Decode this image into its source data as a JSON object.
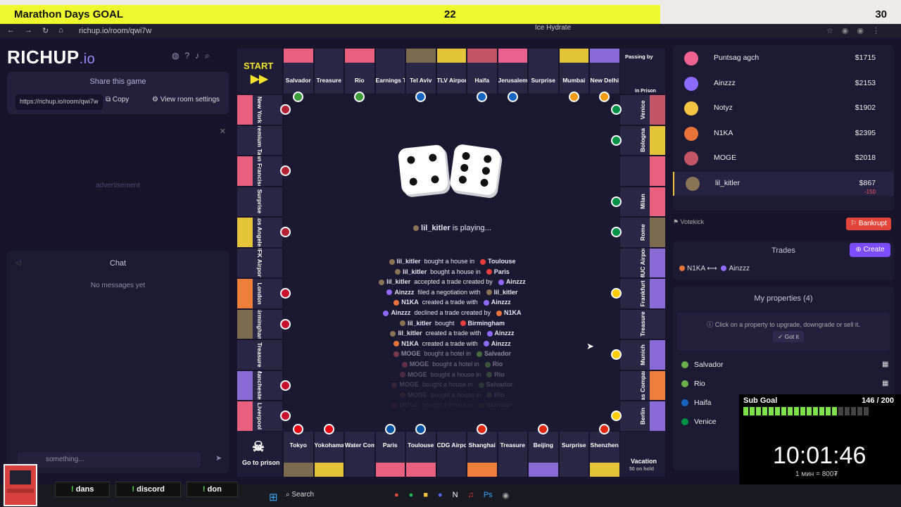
{
  "goal": {
    "title": "Marathon Days GOAL",
    "current": "22",
    "max": "30",
    "progress": 0.733
  },
  "browser": {
    "url": "richup.io/room/qwi7w",
    "tab": "Ice Hydrate"
  },
  "logo": {
    "main": "RICHUP",
    "suffix": ".io"
  },
  "share": {
    "title": "Share this game",
    "url": "https://richup.io/room/qwi7w",
    "copy": "Copy",
    "settings": "View room settings"
  },
  "ad": {
    "label": "advertisement"
  },
  "chat": {
    "title": "Chat",
    "empty": "No messages yet",
    "placeholder": "something..."
  },
  "board": {
    "start": "START",
    "passing": "Passing by",
    "in_prison": "In Prison",
    "go_prison": "Go to prison",
    "vacation": "Vacation",
    "vacation_sub": "50 on hold",
    "top": [
      {
        "name": "Salvador",
        "color": "#ffffff",
        "flag": "br"
      },
      {
        "name": "Treasure",
        "color": "#dba044",
        "label_top": "Treasure"
      },
      {
        "name": "Rio",
        "color": "#ffffff",
        "flag": "br"
      },
      {
        "name": "Earnings Tax",
        "sub": "%10"
      },
      {
        "name": "Tel Aviv",
        "color": "#7b6c4f",
        "flag": "il"
      },
      {
        "name": "TLV Airport",
        "color": "#e4c53a"
      },
      {
        "name": "Haifa",
        "color": "#c25666",
        "flag": "il"
      },
      {
        "name": "Jerusalem",
        "color": "#e7628f",
        "flag": "il"
      },
      {
        "name": "Surprise",
        "label_top": "Surprise"
      },
      {
        "name": "Mumbai",
        "color": "#e4c53a",
        "flag": "in"
      },
      {
        "name": "New Delhi",
        "color": "#8a6bd6",
        "flag": "in"
      }
    ],
    "left": [
      "New York",
      "Premium Tax",
      "San Francisco",
      "Surprise",
      "Los Angeles",
      "JFK Airport",
      "London",
      "Birmingham",
      "Treasure",
      "Manchester",
      "Liverpool"
    ],
    "left_sub": {
      "premium_tax": "$75",
      "jfk": "200$"
    },
    "right": [
      "Venice",
      "Bologna",
      "",
      "Milan",
      "Rome",
      "MUC Airport",
      "Frankfurt",
      "Treasure",
      "Munich",
      "Gas Company",
      "Berlin"
    ],
    "bottom": [
      "Tokyo",
      "Yokohama",
      "Water Company",
      "Paris",
      "Toulouse",
      "CDG Airport",
      "Shanghai",
      "Treasure",
      "Beijing",
      "Surprise",
      "Shenzhen"
    ],
    "bottom_sub": {
      "water": "150$"
    }
  },
  "center": {
    "playing_name": "lil_kitler",
    "playing_text": "is playing...",
    "log": [
      {
        "a": "lil_kitler",
        "ac": "#8b7355",
        "mid": "bought a house in",
        "b": "Toulouse",
        "bc": "#e84040",
        "op": 1
      },
      {
        "a": "lil_kitler",
        "ac": "#8b7355",
        "mid": "bought a house in",
        "b": "Paris",
        "bc": "#e84040",
        "op": 1
      },
      {
        "a": "lil_kitler",
        "ac": "#8b7355",
        "mid": "accepted a trade created by",
        "b": "Ainzzz",
        "bc": "#8b6cff",
        "op": 1
      },
      {
        "a": "Ainzzz",
        "ac": "#8b6cff",
        "mid": "filed a negotiation with",
        "b": "lil_kitler",
        "bc": "#8b7355",
        "op": 1
      },
      {
        "a": "N1KA",
        "ac": "#e9743a",
        "mid": "created a trade with",
        "b": "Ainzzz",
        "bc": "#8b6cff",
        "op": 1
      },
      {
        "a": "Ainzzz",
        "ac": "#8b6cff",
        "mid": "declined a trade created by",
        "b": "N1KA",
        "bc": "#e9743a",
        "op": 1
      },
      {
        "a": "lil_kitler",
        "ac": "#8b7355",
        "mid": "bought",
        "b": "Birmingham",
        "bc": "#e84040",
        "op": 1
      },
      {
        "a": "lil_kitler",
        "ac": "#8b7355",
        "mid": "created a trade with",
        "b": "Ainzzz",
        "bc": "#8b6cff",
        "op": 1
      },
      {
        "a": "N1KA",
        "ac": "#e9743a",
        "mid": "created a trade with",
        "b": "Ainzzz",
        "bc": "#8b6cff",
        "op": 1
      },
      {
        "a": "MOGE",
        "ac": "#c25666",
        "mid": "bought a hotel in",
        "b": "Salvador",
        "bc": "#6ab04c",
        "op": 0.55
      },
      {
        "a": "MOGE",
        "ac": "#c25666",
        "mid": "bought a hotel in",
        "b": "Rio",
        "bc": "#6ab04c",
        "op": 0.42
      },
      {
        "a": "MOGE",
        "ac": "#c25666",
        "mid": "bought a house in",
        "b": "Rio",
        "bc": "#6ab04c",
        "op": 0.3
      },
      {
        "a": "MOGE",
        "ac": "#c25666",
        "mid": "bought a house in",
        "b": "Salvador",
        "bc": "#6ab04c",
        "op": 0.2
      },
      {
        "a": "MOGE",
        "ac": "#c25666",
        "mid": "bought a house in",
        "b": "Rio",
        "bc": "#6ab04c",
        "op": 0.12
      },
      {
        "a": "MOGE",
        "ac": "#c25666",
        "mid": "bought a house in",
        "b": "Salvador",
        "bc": "#6ab04c",
        "op": 0.06
      }
    ]
  },
  "players": [
    {
      "name": "Puntsag agch",
      "money": "$1715",
      "color": "#f06292"
    },
    {
      "name": "Ainzzz",
      "money": "$2153",
      "color": "#8b6cff"
    },
    {
      "name": "Notyz",
      "money": "$1902",
      "color": "#f5c542"
    },
    {
      "name": "N1KA",
      "money": "$2395",
      "color": "#e9743a"
    },
    {
      "name": "MOGE",
      "money": "$2018",
      "color": "#c25666"
    },
    {
      "name": "lil_kitler",
      "money": "$867",
      "color": "#8b7355",
      "delta": "-150"
    }
  ],
  "actions": {
    "votekick": "Votekick",
    "bankrupt": "Bankrupt"
  },
  "trades": {
    "title": "Trades",
    "create": "Create",
    "from": "N1KA",
    "to": "Ainzzz"
  },
  "myprops": {
    "title": "My properties (4)",
    "hint": "Click on a property to upgrade, downgrade or sell it.",
    "got_it": "Got it",
    "items": [
      "Salvador",
      "Rio",
      "Haifa",
      "Venice"
    ]
  },
  "subgoal": {
    "title": "Sub Goal",
    "value": "146 / 200",
    "progress": 0.73,
    "time": "10:01:46",
    "rate": "1 мин = 800₮"
  },
  "taskbar": {
    "cmds": [
      "dans",
      "discord",
      "don"
    ],
    "search": "Search"
  }
}
